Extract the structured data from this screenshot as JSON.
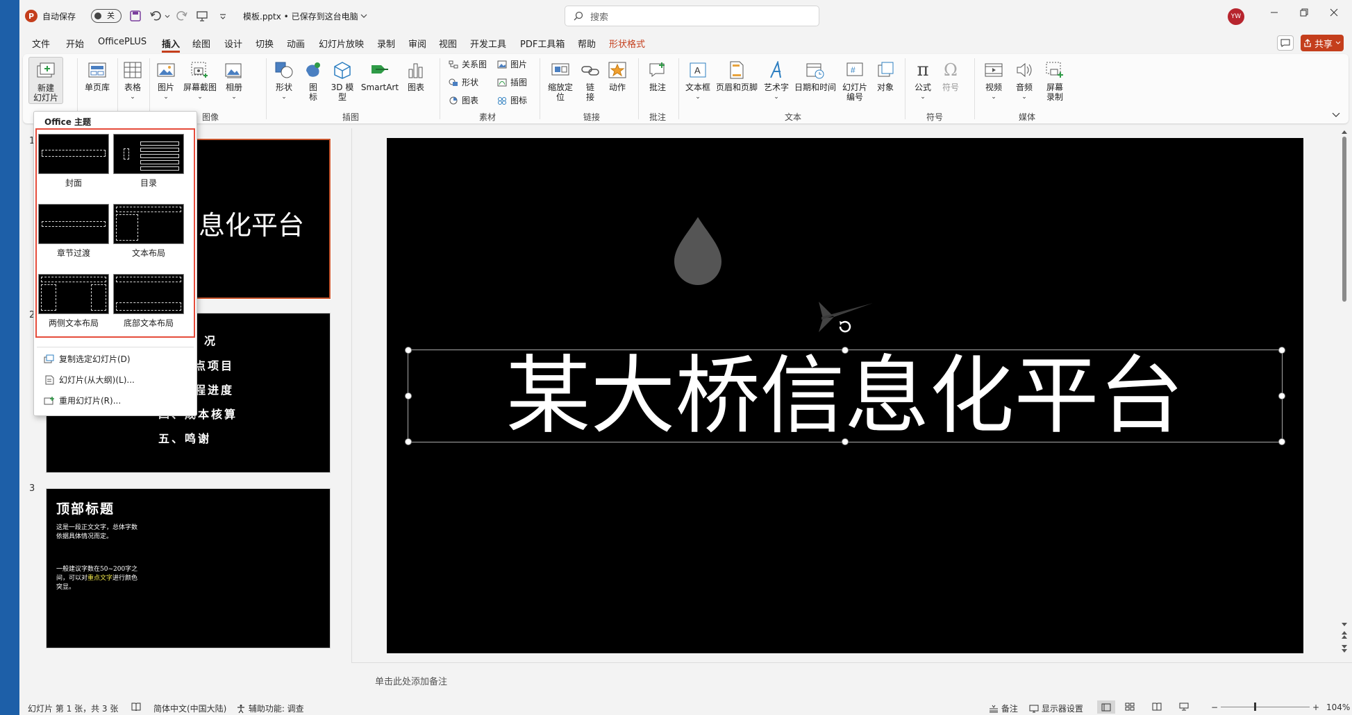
{
  "titlebar": {
    "app_icon": "P",
    "autosave_label": "自动保存",
    "autosave_state": "关",
    "doc_title": "模板.pptx • 已保存到这台电脑",
    "search_placeholder": "搜索",
    "user_initials": "YW"
  },
  "menu_tabs": [
    "文件",
    "开始",
    "OfficePLUS",
    "插入",
    "绘图",
    "设计",
    "切换",
    "动画",
    "幻灯片放映",
    "录制",
    "审阅",
    "视图",
    "开发工具",
    "PDF工具箱",
    "帮助",
    "形状格式"
  ],
  "active_tab": "插入",
  "share_label": "共享",
  "ribbon": {
    "new_slide": "新建\n幻灯片",
    "single_page": "单页库",
    "table": "表格",
    "picture": "图片",
    "screenshot": "屏幕截图",
    "album": "相册",
    "shapes": "形状",
    "icons": "图\n标",
    "model3d": "3D 模\n型",
    "smartart": "SmartArt",
    "chart": "图表",
    "relations": "关系图",
    "shape_small": "形状",
    "chart_small": "图表",
    "picture_small": "图片",
    "illustration": "插图",
    "icon_small": "图标",
    "zoom": "缩放定\n位",
    "link": "链\n接",
    "action": "动作",
    "comment": "批注",
    "textbox": "文本框",
    "header_footer": "页眉和页脚",
    "wordart": "艺术字",
    "datetime": "日期和时间",
    "slide_number": "幻灯片\n编号",
    "object": "对象",
    "equation": "公式",
    "symbol": "符号",
    "video": "视频",
    "audio": "音频",
    "screen_record": "屏幕\n录制",
    "groups": {
      "image": "图像",
      "illustrations": "插图",
      "material": "素材",
      "links": "链接",
      "comments": "批注",
      "text": "文本",
      "symbols": "符号",
      "media": "媒体"
    }
  },
  "dropdown": {
    "title": "Office 主题",
    "layouts": [
      "封面",
      "目录",
      "章节过渡",
      "文本布局",
      "两侧文本布局",
      "底部文本布局"
    ],
    "items": [
      "复制选定幻灯片(D)",
      "幻灯片(从大纲)(L)...",
      "重用幻灯片(R)..."
    ]
  },
  "thumbnails": [
    {
      "num": "1",
      "text": "息化平台"
    },
    {
      "num": "2",
      "lines": [
        "况",
        "点项目",
        "程进度",
        "四、成本核算",
        "五、鸣谢"
      ]
    },
    {
      "num": "3",
      "title": "顶部标题",
      "p1": "这是一段正文文字，总体字数依据具体情况而定。",
      "p2a": "一般建议字数在50~200字之间，可以对",
      "p2b": "重点文字",
      "p2c": "进行颜色突显。"
    }
  ],
  "slide": {
    "title": "某大桥信息化平台"
  },
  "notes_placeholder": "单击此处添加备注",
  "statusbar": {
    "slide_info": "幻灯片 第 1 张，共 3 张",
    "language": "简体中文(中国大陆)",
    "accessibility": "辅助功能: 调查",
    "notes": "备注",
    "display_settings": "显示器设置",
    "zoom": "104%"
  },
  "colors": {
    "accent": "#c43e1c",
    "highlight_border": "#e54b3a",
    "slide_bg": "#000000"
  }
}
